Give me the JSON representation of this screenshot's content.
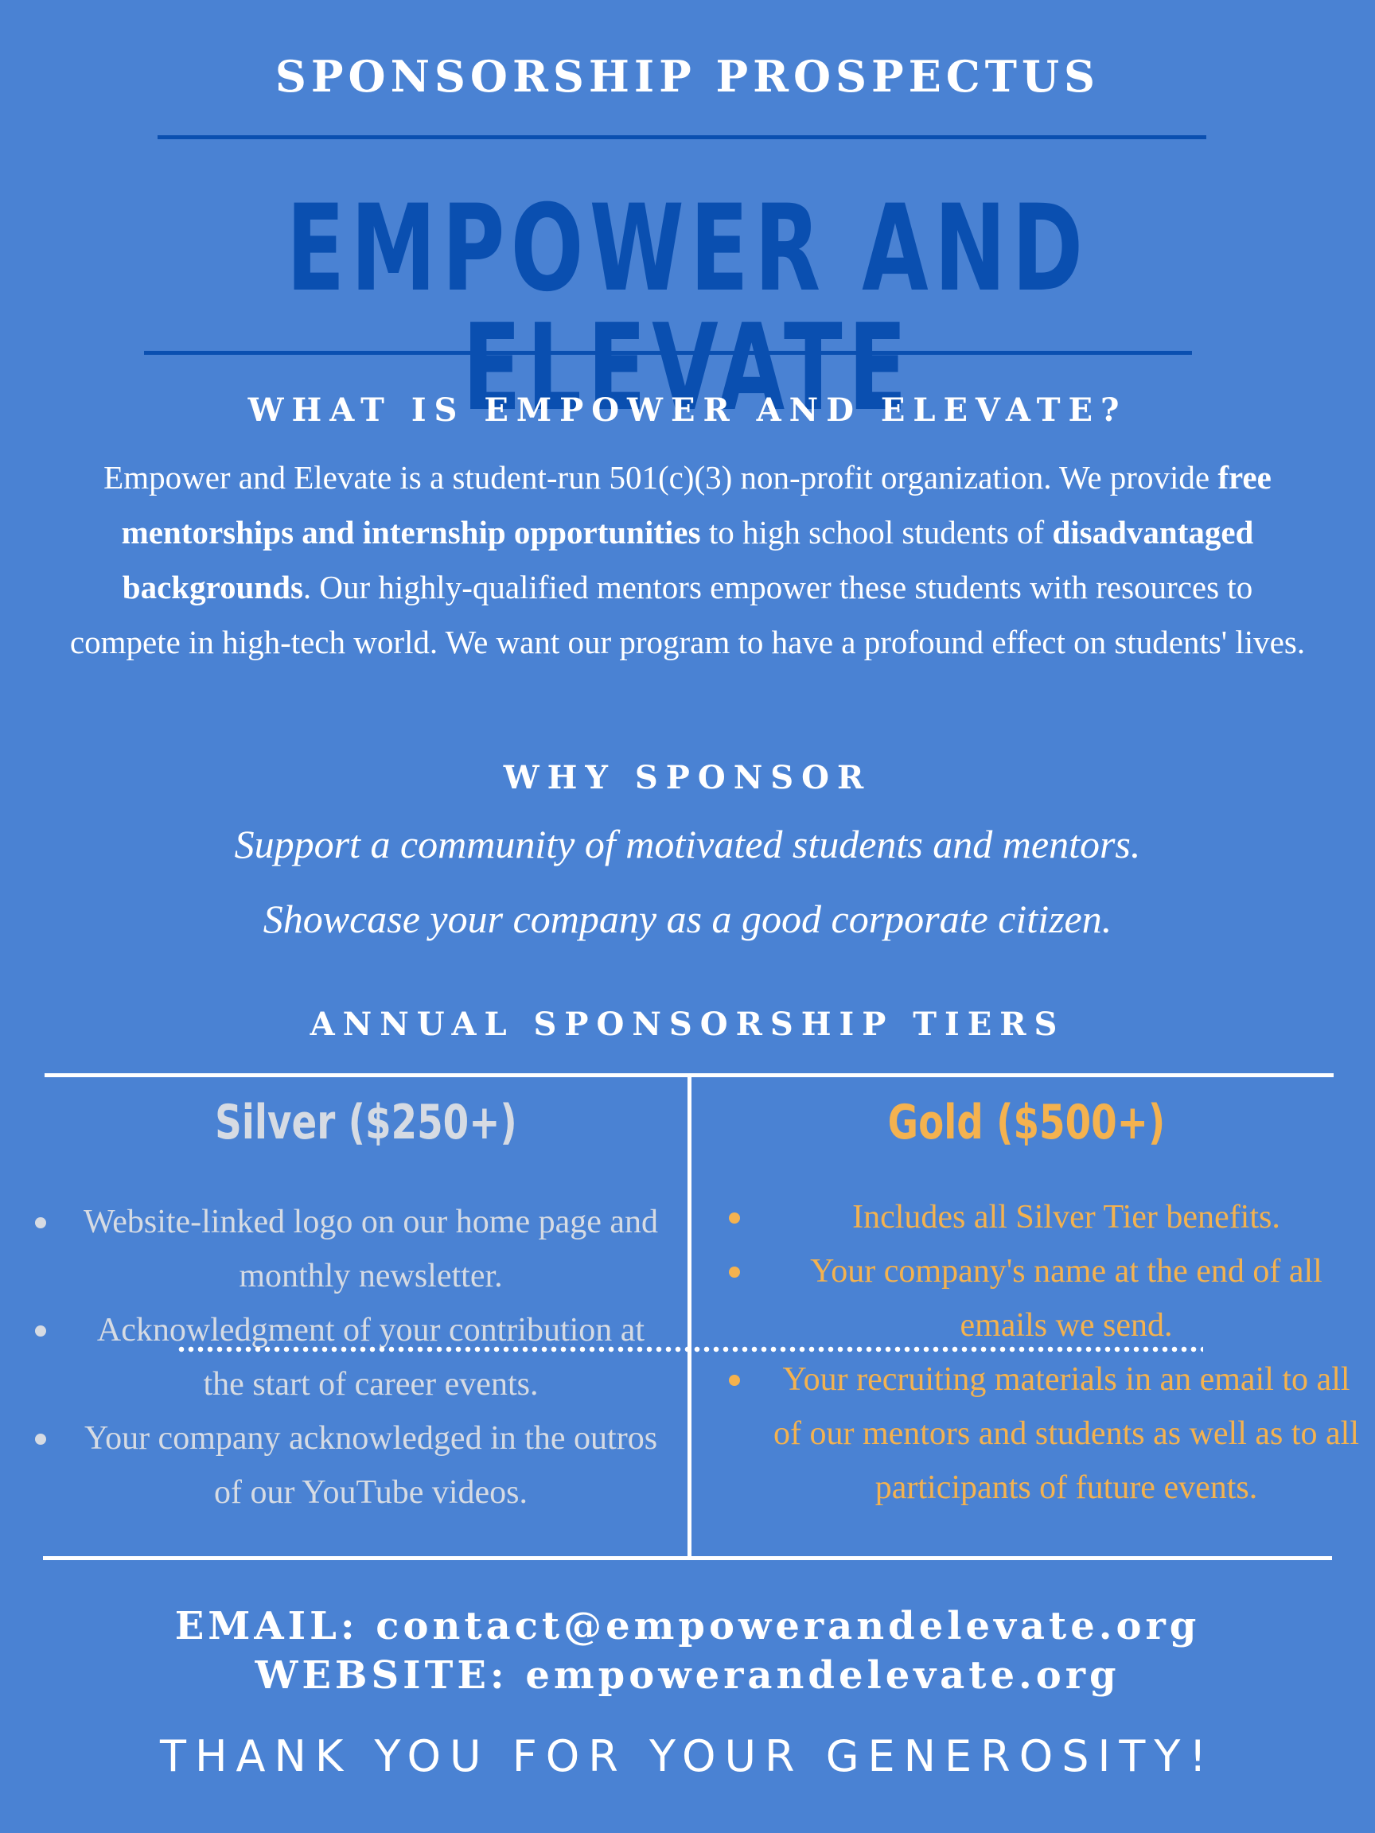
{
  "header": {
    "eyebrow": "SPONSORSHIP PROSPECTUS",
    "title": "EMPOWER AND ELEVATE"
  },
  "about": {
    "heading": "WHAT IS EMPOWER AND ELEVATE?",
    "text_1": "Empower and Elevate is a student-run 501(c)(3) non-profit organization. We provide ",
    "bold_1": "free mentorships and internship opportunities",
    "text_2": " to high school students of ",
    "bold_2": "disadvantaged backgrounds",
    "text_3": ". Our highly-qualified mentors empower these students with resources to compete in high-tech world. We want our program to have a profound effect on students' lives."
  },
  "why": {
    "heading": "WHY SPONSOR",
    "lines": [
      "Support a community of motivated students and mentors.",
      "Showcase your company as a good corporate citizen."
    ]
  },
  "tiers": {
    "heading": "ANNUAL SPONSORSHIP TIERS",
    "silver": {
      "title": "Silver ($250+)",
      "color": "#d6dbe3",
      "items": [
        "Website-linked logo on our home page and monthly newsletter.",
        "Acknowledgment of your contribution at the start of career events.",
        "Your company acknowledged in the outros of our YouTube videos."
      ]
    },
    "gold": {
      "title": "Gold ($500+)",
      "color": "#f4b24f",
      "items": [
        "Includes all Silver Tier benefits.",
        "Your company's name at the end of all emails we send.",
        "Your recruiting materials in an email to all of  our mentors and students as well as to all participants of future events."
      ]
    }
  },
  "contact": {
    "email": "EMAIL: contact@empowerandelevate.org",
    "website": "WEBSITE: empowerandelevate.org"
  },
  "footer": {
    "thanks": "THANK YOU FOR YOUR GENEROSITY!"
  },
  "colors": {
    "background": "#4a82d3",
    "title": "#0a4fb0"
  }
}
